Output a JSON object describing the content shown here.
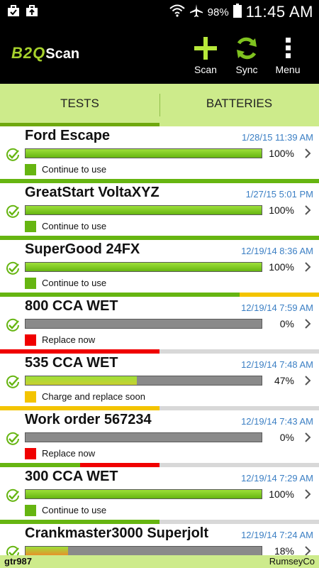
{
  "status_bar": {
    "battery_pct": "98%",
    "time": "11:45 AM",
    "icons": [
      "briefcase-check-icon",
      "briefcase-upload-icon",
      "wifi-icon",
      "airplane-icon",
      "battery-icon"
    ]
  },
  "app": {
    "logo_part1": "B2Q",
    "logo_part2": "Scan",
    "actions": {
      "scan": "Scan",
      "sync": "Sync",
      "menu": "Menu"
    }
  },
  "tabs": [
    {
      "label": "TESTS",
      "active": true
    },
    {
      "label": "BATTERIES",
      "active": false
    }
  ],
  "colors": {
    "green": "#66b511",
    "red": "#f00000",
    "yellow": "#f3c400",
    "orange": "#f0a020",
    "date_blue": "#3b7fc4",
    "accent_green": "#a6d12c"
  },
  "tests": [
    {
      "name": "Ford Escape",
      "date": "1/28/15 11:39 AM",
      "percent_label": "100%",
      "level": 1.0,
      "status": "Continue to use",
      "status_color": "green",
      "sep_level": 1.0,
      "sep_color": "green"
    },
    {
      "name": "GreatStart VoltaXYZ",
      "date": "1/27/15 5:01 PM",
      "percent_label": "100%",
      "level": 1.0,
      "status": "Continue to use",
      "status_color": "green",
      "sep_level": 1.0,
      "sep_color": "green"
    },
    {
      "name": "SuperGood 24FX",
      "date": "12/19/14 8:36 AM",
      "percent_label": "100%",
      "level": 1.0,
      "status": "Continue to use",
      "status_color": "green",
      "sep_level": 0.75,
      "sep_color": "green",
      "sep_rest_color": "yellow"
    },
    {
      "name": "800 CCA WET",
      "date": "12/19/14 7:59 AM",
      "percent_label": "0%",
      "level": 0.0,
      "status": "Replace now",
      "status_color": "red",
      "sep_level": 0.5,
      "sep_color": "red"
    },
    {
      "name": "535 CCA WET",
      "date": "12/19/14 7:48 AM",
      "percent_label": "47%",
      "level": 0.47,
      "status": "Charge and replace soon",
      "status_color": "yellow",
      "sep_level": 0.5,
      "sep_color": "yellow"
    },
    {
      "name": "Work order 567234",
      "date": "12/19/14 7:43 AM",
      "percent_label": "0%",
      "level": 0.0,
      "status": "Replace now",
      "status_color": "red",
      "sep_level": 0.5,
      "sep_color": "green_red"
    },
    {
      "name": "300 CCA WET",
      "date": "12/19/14 7:29 AM",
      "percent_label": "100%",
      "level": 1.0,
      "status": "Continue to use",
      "status_color": "green",
      "sep_level": 0.5,
      "sep_color": "green"
    },
    {
      "name": "Crankmaster3000 Superjolt",
      "date": "12/19/14 7:24 AM",
      "percent_label": "18%",
      "level": 0.18,
      "status": "",
      "status_color": "orange",
      "sep_level": 0,
      "sep_color": "orange"
    }
  ],
  "footer": {
    "user": "gtr987",
    "org": "RumseyCo"
  }
}
